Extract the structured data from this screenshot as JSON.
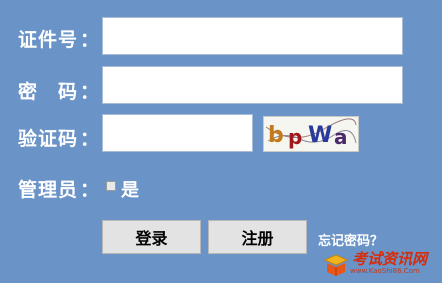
{
  "form": {
    "id_label": "证件号",
    "password_label": "密　码",
    "captcha_label": "验证码",
    "admin_label": "管理员",
    "colon": "：",
    "id_value": "",
    "password_value": "",
    "captcha_value": "",
    "captcha_text": "bpWa",
    "admin_option_label": "是",
    "admin_checked": false
  },
  "buttons": {
    "login_label": "登录",
    "register_label": "注册"
  },
  "forgot_label": "忘记密码？",
  "watermark": {
    "name": "考试资讯网",
    "url": "www.KaoShi86.Com"
  },
  "colors": {
    "background": "#6a93c7",
    "button": "#e3e3e3",
    "watermark": "#d62c0a"
  }
}
